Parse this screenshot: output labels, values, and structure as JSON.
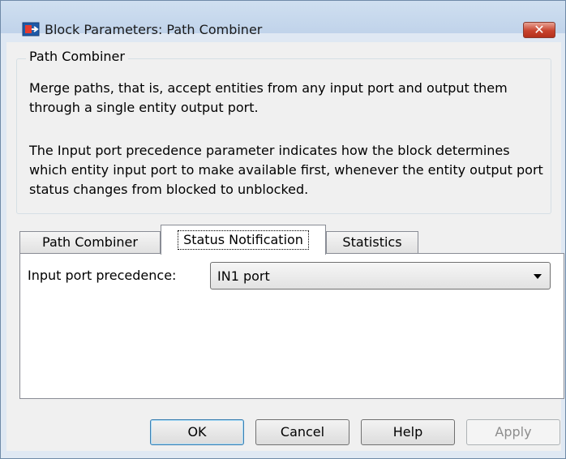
{
  "window": {
    "title": "Block Parameters: Path Combiner",
    "close_glyph": "✕",
    "accent_close": "#c8432d"
  },
  "description": {
    "group_title": "Path Combiner",
    "paragraph1": "Merge paths, that is, accept entities from any input port and output them through a single entity output port.",
    "paragraph2": "The Input port precedence parameter indicates how the block determines which entity input port to make available first, whenever the entity output port status changes from blocked to unblocked."
  },
  "tabs": [
    {
      "label": "Path Combiner",
      "active": false
    },
    {
      "label": "Status Notification",
      "active": true
    },
    {
      "label": "Statistics",
      "active": false
    }
  ],
  "params": {
    "input_port_precedence_label": "Input port precedence:",
    "input_port_precedence_value": "IN1 port"
  },
  "buttons": {
    "ok": "OK",
    "cancel": "Cancel",
    "help": "Help",
    "apply": "Apply"
  },
  "icons": {
    "app": "simulink-block-icon",
    "close": "close-icon",
    "dropdown": "chevron-down-icon"
  }
}
